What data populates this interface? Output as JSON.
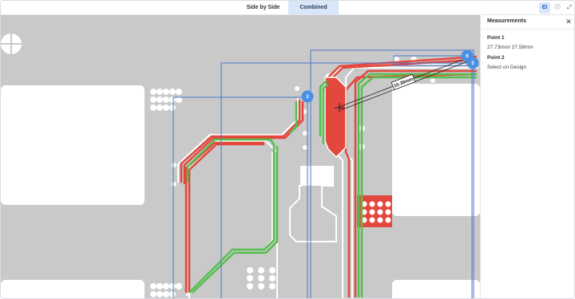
{
  "tabs": {
    "side_by_side": "Side by Side",
    "combined": "Combined"
  },
  "toolbar": {
    "measure_icon": "EI",
    "info_icon": "ⓘ",
    "expand_icon": "⤢"
  },
  "panel": {
    "title": "Measurements",
    "close": "✕",
    "point1_label": "Point 1",
    "point1_value": "27.73mm/ 27.58mm",
    "point2_label": "Point 2",
    "point2_value": "Select on Design"
  },
  "canvas": {
    "measurement_label": "10.39mm",
    "markers": [
      "3",
      "6",
      "5"
    ]
  },
  "colors": {
    "board": "#c9c9ca",
    "pad": "#ffffff",
    "trace_red": "#e2483d",
    "trace_green": "#55bf4e",
    "selection": "#4a78c9",
    "marker": "#4a90e2"
  }
}
